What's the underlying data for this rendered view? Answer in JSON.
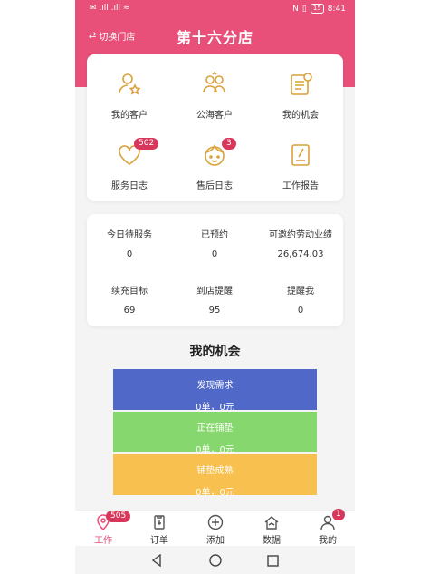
{
  "status": {
    "left": "✉ .ıll .ıll ≈",
    "battery": "15",
    "time": "8:41"
  },
  "nav": {
    "switch_label": "切换门店",
    "title": "第十六分店"
  },
  "menu": [
    {
      "label": "我的客户",
      "icon": "customer-star-icon"
    },
    {
      "label": "公海客户",
      "icon": "customer-group-icon"
    },
    {
      "label": "我的机会",
      "icon": "opportunity-icon"
    },
    {
      "label": "服务日志",
      "icon": "heart-icon",
      "badge": "502"
    },
    {
      "label": "售后日志",
      "icon": "face-icon",
      "badge": "3"
    },
    {
      "label": "工作报告",
      "icon": "report-icon"
    }
  ],
  "stats": [
    {
      "label": "今日待服务",
      "value": "0"
    },
    {
      "label": "已预约",
      "value": "0"
    },
    {
      "label": "可邀约劳动业绩",
      "value": "26,674.03"
    },
    {
      "label": "续充目标",
      "value": "69"
    },
    {
      "label": "到店提醒",
      "value": "95"
    },
    {
      "label": "提醒我",
      "value": "0"
    }
  ],
  "section_title": "我的机会",
  "opportunities": [
    {
      "label": "发现需求",
      "count": "0单，0元",
      "color": "#5068c8"
    },
    {
      "label": "正在铺垫",
      "count": "0单，0元",
      "color": "#86d86e"
    },
    {
      "label": "铺垫成熟",
      "count": "0单，0元",
      "color": "#f7c04f"
    }
  ],
  "tabs": [
    {
      "label": "工作",
      "icon": "work-icon",
      "badge": "505"
    },
    {
      "label": "订单",
      "icon": "order-icon"
    },
    {
      "label": "添加",
      "icon": "add-circle-icon"
    },
    {
      "label": "数据",
      "icon": "home-data-icon"
    },
    {
      "label": "我的",
      "icon": "person-icon",
      "badge": "1"
    }
  ],
  "colors": {
    "brand": "#e8507a",
    "icon_gold": "#d9a23a",
    "badge": "#d9365b"
  }
}
